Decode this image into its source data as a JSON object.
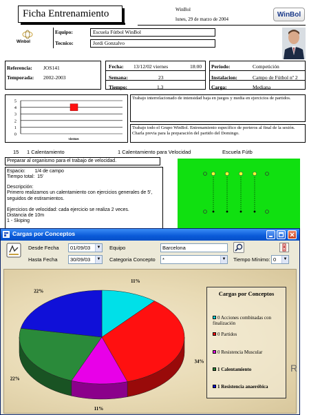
{
  "report": {
    "title": "Ficha Entrenamiento",
    "club_name": "WinBol",
    "date_line": "lunes, 29 de marzo de 2004",
    "brand_logo": "WinBol",
    "small_logo": "Winbol",
    "equipo_label": "Equipo:",
    "equipo_value": "Escuela Fútbol WinBol",
    "tecnico_label": "Tecnico:",
    "tecnico_value": "Jordi Gonzalvo",
    "referencia_label": "Referencia:",
    "referencia_value": "JOS141",
    "temporada_label": "Temporada:",
    "temporada_value": "2002-2003",
    "fecha_label": "Fecha:",
    "fecha_value": "13/12/02 viernes",
    "hora_value": "18:00",
    "semana_label": "Semana:",
    "semana_value": "23",
    "tiempo_label": "Tiempo:",
    "tiempo_value": "1,3",
    "periodo_label": "Periodo:",
    "periodo_value": "Competición",
    "instalacion_label": "Instalacion:",
    "instalacion_value": "Campo de Fútbol nº 2",
    "carga_label": "Carga:",
    "carga_value": "Mediana",
    "mini_chart_ticks": [
      "5",
      "4",
      "3",
      "2",
      "1",
      "0"
    ],
    "mini_chart_xlabel": "viernes",
    "mini_chart_value": 4,
    "note1": "Trabajo interrelacionado de intensidad baja en juegos y media en ejercicios de partidos.",
    "note2": "Trabajo todo el Grupo WinBol. Entrenamiento específico de porteros al final de la sesión. Charla previa para la preparación del partido del Domingo.",
    "exercise_number": "15",
    "exercise_name": "1 Calentamiento",
    "exercise_type": "1 Calentamiento para Velocidad",
    "exercise_school": "Escuela Fútb",
    "exercise_objective": "Preparar al organismo  para el trabajo de velocidad.",
    "espacio_line": "Espacio:       1/4 de campo",
    "tiempo_line": "Tiempo total:  15'",
    "descripcion_label": "Descripción:",
    "descripcion_text": "Primero realizamos un calentamiento con ejercicios generales de 5', seguidos de estiramientos.",
    "ejercicios_line": "Ejercicios de velocidad: cada ejercicio se realiza 2 veces.",
    "distancia_line": "Distancia de 10m",
    "skipping_line": "1 - Skiping"
  },
  "window": {
    "title": "Cargas por Conceptos",
    "desde_label": "Desde Fecha",
    "desde_value": "01/09/03",
    "hasta_label": "Hasta Fecha",
    "hasta_value": "30/09/03",
    "equipo_label": "Equipo",
    "equipo_value": "Barcelona",
    "categoria_label": "Categoria Concepto",
    "categoria_value": "*",
    "tiempo_minimo_label": "Tiempo Mínimo:",
    "tiempo_minimo_value": "0",
    "side_letter": "R"
  },
  "chart_data": {
    "type": "pie",
    "title": "Cargas por Conceptos",
    "legend_position": "right",
    "slices": [
      {
        "name": "0 Acciones combinadas con finalización",
        "value": 11,
        "label": "11%",
        "color": "#00e0e8"
      },
      {
        "name": "0 Partidos",
        "value": 34,
        "label": "34%",
        "color": "#ff1010"
      },
      {
        "name": "0 Resistencia Muscular",
        "value": 11,
        "label": "11%",
        "color": "#e800e8"
      },
      {
        "name": "1 Calentamiento",
        "value": 22,
        "label": "22%",
        "color": "#2a8a3a"
      },
      {
        "name": "1 Resistencia anaeróbica",
        "value": 22,
        "label": "22%",
        "color": "#1010d8"
      }
    ]
  }
}
